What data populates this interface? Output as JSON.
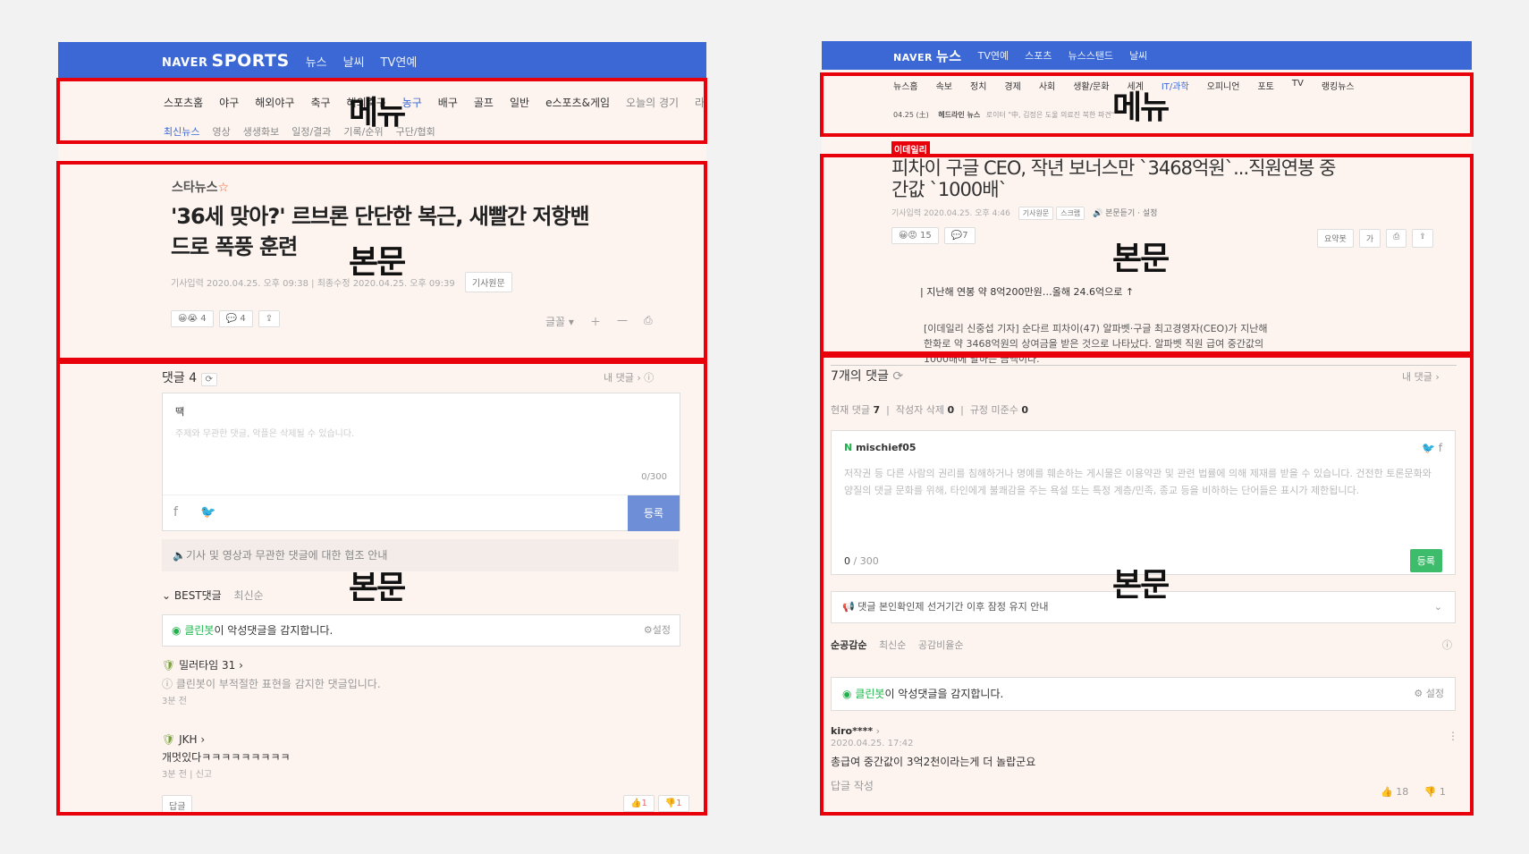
{
  "left": {
    "header": {
      "logo_naver": "NAVER",
      "logo_sports": "SPORTS",
      "nav": [
        "뉴스",
        "날씨",
        "TV연예"
      ]
    },
    "menu": {
      "primary": [
        "스포츠홈",
        "야구",
        "해외야구",
        "축구",
        "해외축구",
        "농구",
        "배구",
        "골프",
        "일반",
        "e스포츠&게임",
        "오늘의 경기",
        "라"
      ],
      "secondary": [
        "최신뉴스",
        "영상",
        "생생화보",
        "일정/결과",
        "기록/순위",
        "구단/협회"
      ]
    },
    "article": {
      "source": "스타뉴스",
      "title_line1": "'36세 맞아?' 르브론 단단한 복근, 새빨간 저항밴",
      "title_line2": "드로 폭풍 훈련",
      "meta": "기사입력 2020.04.25. 오후 09:38 | 최종수정 2020.04.25. 오후 09:39",
      "original_button": "기사원문",
      "reaction_count": "4",
      "comment_count": "4",
      "font_label": "글꼴"
    },
    "comments": {
      "title": "댓글 4",
      "mine": "내 댓글",
      "input_user": "땍",
      "input_placeholder": "주제와 무관한 댓글, 악플은 삭제될 수 있습니다.",
      "counter": "0/300",
      "submit": "등록",
      "notice": "기사 및 영상과 무관한 댓글에 대한 협조 안내",
      "sort_best": "BEST댓글",
      "sort_latest": "최신순",
      "cleanbot_name": "클린봇",
      "cleanbot_text": "이 악성댓글을 감지합니다.",
      "settings": "설정",
      "c1_user": "밀러타임 31",
      "c1_text": "클린봇이 부적절한 표현을 감지한 댓글입니다.",
      "c1_time": "3분 전",
      "c2_user": "JKH",
      "c2_text": "개멋있다ㅋㅋㅋㅋㅋㅋㅋㅋㅋ",
      "c2_time": "3분 전",
      "report": "신고",
      "reply": "답글",
      "like": "1",
      "dislike": "1"
    }
  },
  "right": {
    "header": {
      "logo_naver": "NAVER",
      "logo_news": "뉴스",
      "nav": [
        "TV연예",
        "스포츠",
        "뉴스스탠드",
        "날씨"
      ]
    },
    "menu": {
      "primary": [
        "뉴스홈",
        "속보",
        "정치",
        "경제",
        "사회",
        "생활/문화",
        "세계",
        "IT/과학",
        "오피니언",
        "포토",
        "TV",
        "랭킹뉴스"
      ],
      "headline_date": "04.25 (土)",
      "headline_label": "헤드라인 뉴스",
      "headline_text": "로이터 \"中, 김정은 도울 의료진 북한 파견\""
    },
    "article": {
      "press": "이데일리",
      "title_line1": "피차이 구글 CEO, 작년 보너스만 `3468억원`...직원연봉 중",
      "title_line2": "간값 `1000배`",
      "meta": "기사입력 2020.04.25. 오후 4:46",
      "original_button": "기사원문",
      "scrap": "스크랩",
      "listen": "본문듣기 · 설정",
      "reaction_count": "15",
      "comment_count": "7",
      "summary": "요약봇",
      "font": "가",
      "subhead": "| 지난해 연봉 약 8억200만원…올해 24.6억으로 ↑",
      "body_line1": "[이데일리 신중섭 기자] 순다르 피차이(47) 알파벳·구글 최고경영자(CEO)가 지난해",
      "body_line2": "한화로 약 3468억원의 상여금을 받은 것으로 나타났다. 알파벳 직원 급여 중간값의",
      "body_line3": "1000배에 달하는 금액이다."
    },
    "comments": {
      "title": "7개의 댓글",
      "mine": "내 댓글",
      "stat_current_label": "현재 댓글",
      "stat_current": "7",
      "stat_deleted_label": "작성자 삭제",
      "stat_deleted": "0",
      "stat_rule_label": "규정 미준수",
      "stat_rule": "0",
      "user": "mischief05",
      "guideline": "저작권 등 다른 사람의 권리를 침해하거나 명예를 훼손하는 게시물은 이용약관 및 관련 법률에 의해 제재를 받을 수 있습니다. 건전한 토론문화와 양질의 댓글 문화를 위해, 타인에게 불쾌감을 주는 욕설 또는 특정 계층/민족, 종교 등을 비하하는 단어들은 표시가 제한됩니다.",
      "counter_current": "0",
      "counter_max": "/ 300",
      "submit": "등록",
      "notice": "댓글 본인확인제 선거기간 이후 잠정 유지 안내",
      "sort_1": "순공감순",
      "sort_2": "최신순",
      "sort_3": "공감비율순",
      "cleanbot_name": "클린봇",
      "cleanbot_text": "이 악성댓글을 감지합니다.",
      "settings": "설정",
      "c_user": "kiro****",
      "c_time": "2020.04.25. 17:42",
      "c_text": "총급여 중간값이 3억2천이라는게 더 놀랍군요",
      "reply": "답글 작성",
      "likes": "18",
      "dislikes": "1"
    }
  },
  "overlay_labels": {
    "menu": "메뉴",
    "body": "본문"
  },
  "colors": {
    "highlight_border": "#e8000b",
    "naver_blue": "#3b68d4",
    "submit_green": "#3dbd6c",
    "submit_blue": "#6e8fd8"
  }
}
